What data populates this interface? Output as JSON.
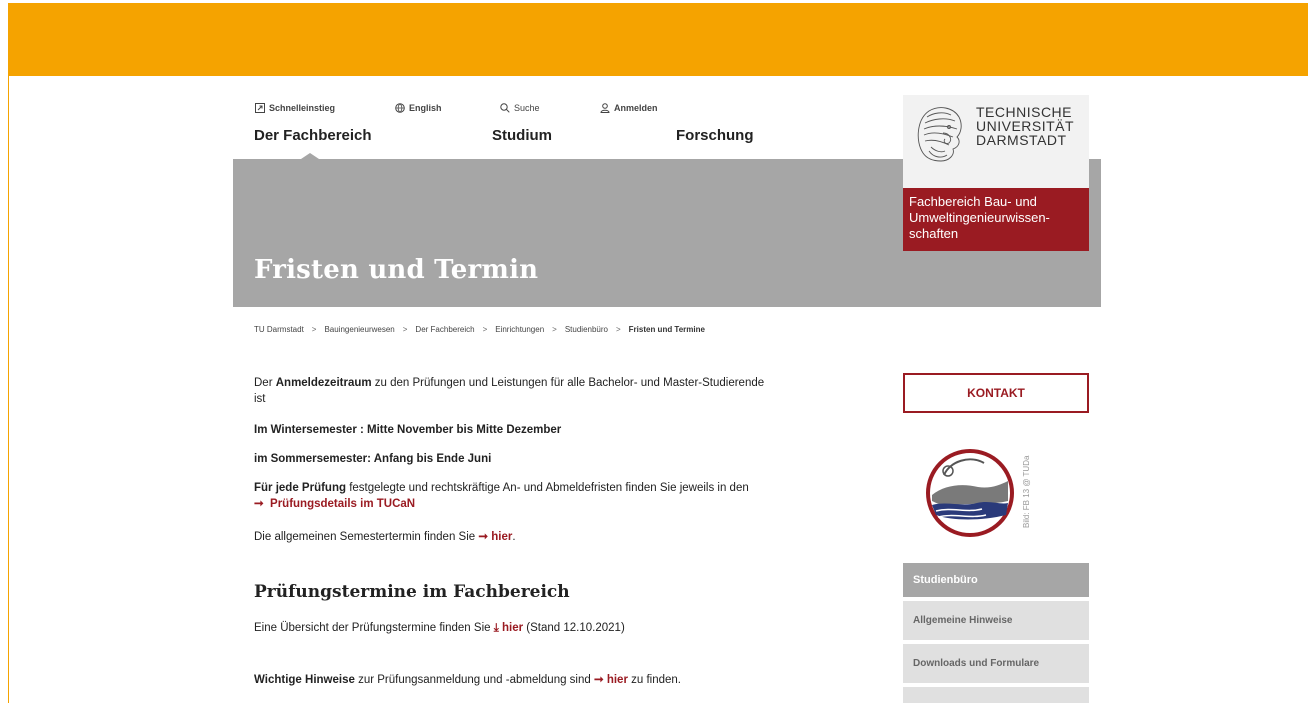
{
  "meta_nav": {
    "quick_access": "Schnelleinstieg",
    "language": "English",
    "search": "Suche",
    "login": "Anmelden"
  },
  "main_nav": {
    "items": [
      "Der Fachbereich",
      "Studium",
      "Forschung"
    ]
  },
  "hero": {
    "title": "Fristen und Termin"
  },
  "logo": {
    "line1": "TECHNISCHE",
    "line2": "UNIVERSITÄT",
    "line3": "DARMSTADT"
  },
  "department": {
    "line1": "Fachbereich Bau- und",
    "line2": "Umweltingenieurwissen-",
    "line3": "schaften"
  },
  "breadcrumb": [
    "TU Darmstadt",
    "Bauingenieurwesen",
    "Der Fachbereich",
    "Einrichtungen",
    "Studienbüro",
    "Fristen und Termine"
  ],
  "content": {
    "p1_pre": "Der ",
    "p1_bold": "Anmeldezeitraum",
    "p1_post": " zu den Prüfungen und Leistungen für alle Bachelor- und Master-Studierende ist",
    "winter": "Im Wintersemester : Mitte November bis Mitte Dezember",
    "summer": "im Sommersemester: Anfang bis Ende Juni",
    "p4_bold": "Für jede Prüfung",
    "p4_post": " festgelegte und rechtskräftige An- und Abmeldefristen finden Sie jeweils in den",
    "p4_link": "Prüfungsdetails im TUCaN",
    "p5_pre": "Die allgemeinen Semestertermin finden Sie ",
    "p5_link": "hier",
    "p5_post": ".",
    "section_title": "Prüfungstermine im Fachbereich",
    "p6_pre": "Eine Übersicht der Prüfungstermine finden Sie ",
    "p6_link": "hier",
    "p6_post": " (Stand 12.10.2021)",
    "p7_bold": "Wichtige Hinweise",
    "p7_mid": " zur Prüfungsanmeldung und -abmeldung sind ",
    "p7_link": "hier",
    "p7_post": " zu finden."
  },
  "sidebar": {
    "contact_button": "KONTAKT",
    "image_credit": "Bild: FB 13 @ TUDa",
    "nav_title": "Studienbüro",
    "nav_items": [
      "Allgemeine Hinweise",
      "Downloads und Formulare"
    ]
  },
  "colors": {
    "brand_orange": "#f5a300",
    "brand_red": "#9a1b22",
    "hero_gray": "#a6a6a6"
  }
}
